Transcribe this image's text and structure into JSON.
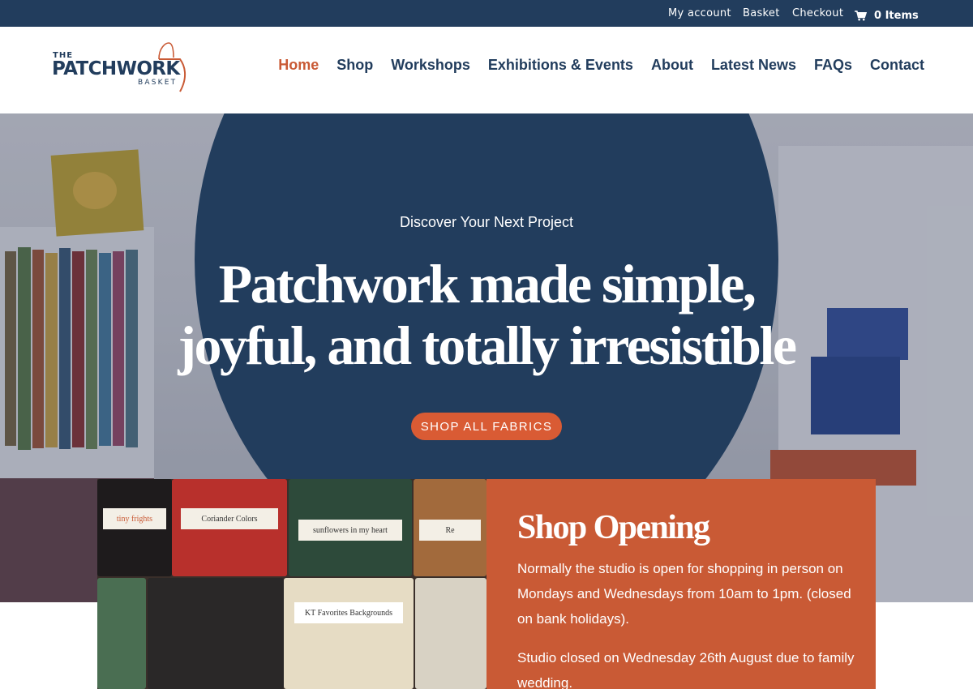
{
  "topbar": {
    "my_account": "My account",
    "basket": "Basket",
    "checkout": "Checkout",
    "cart_count": "0 Items",
    "cart_icon": "cart-icon"
  },
  "logo": {
    "the": "THE",
    "patchwork": "PATCHWORK",
    "basket": "BASKET",
    "icon": "basket-handle-icon"
  },
  "nav": {
    "items": [
      "Home",
      "Shop",
      "Workshops",
      "Exhibitions & Events",
      "About",
      "Latest News",
      "FAQs",
      "Contact"
    ],
    "active": "Home"
  },
  "hero": {
    "tagline": "Discover Your Next Project",
    "headline_line1": "Patchwork made simple,",
    "headline_line2": "joyful, and totally irresistible",
    "cta": "SHOP ALL FABRICS"
  },
  "photo": {
    "labels": [
      "tiny frights",
      "Coriander Colors",
      "sunflowers in my heart",
      "Re",
      "KT Favorites Backgrounds"
    ]
  },
  "card": {
    "title": "Shop Opening",
    "paragraph1": "Normally the studio is open for shopping in person on Mondays and Wednesdays from 10am to 1pm. (closed on bank holidays).",
    "paragraph2": "Studio closed on Wednesday 26th August due to family wedding."
  },
  "colors": {
    "navy": "#223d5d",
    "accent": "#c95a35",
    "button": "#d95b34"
  }
}
